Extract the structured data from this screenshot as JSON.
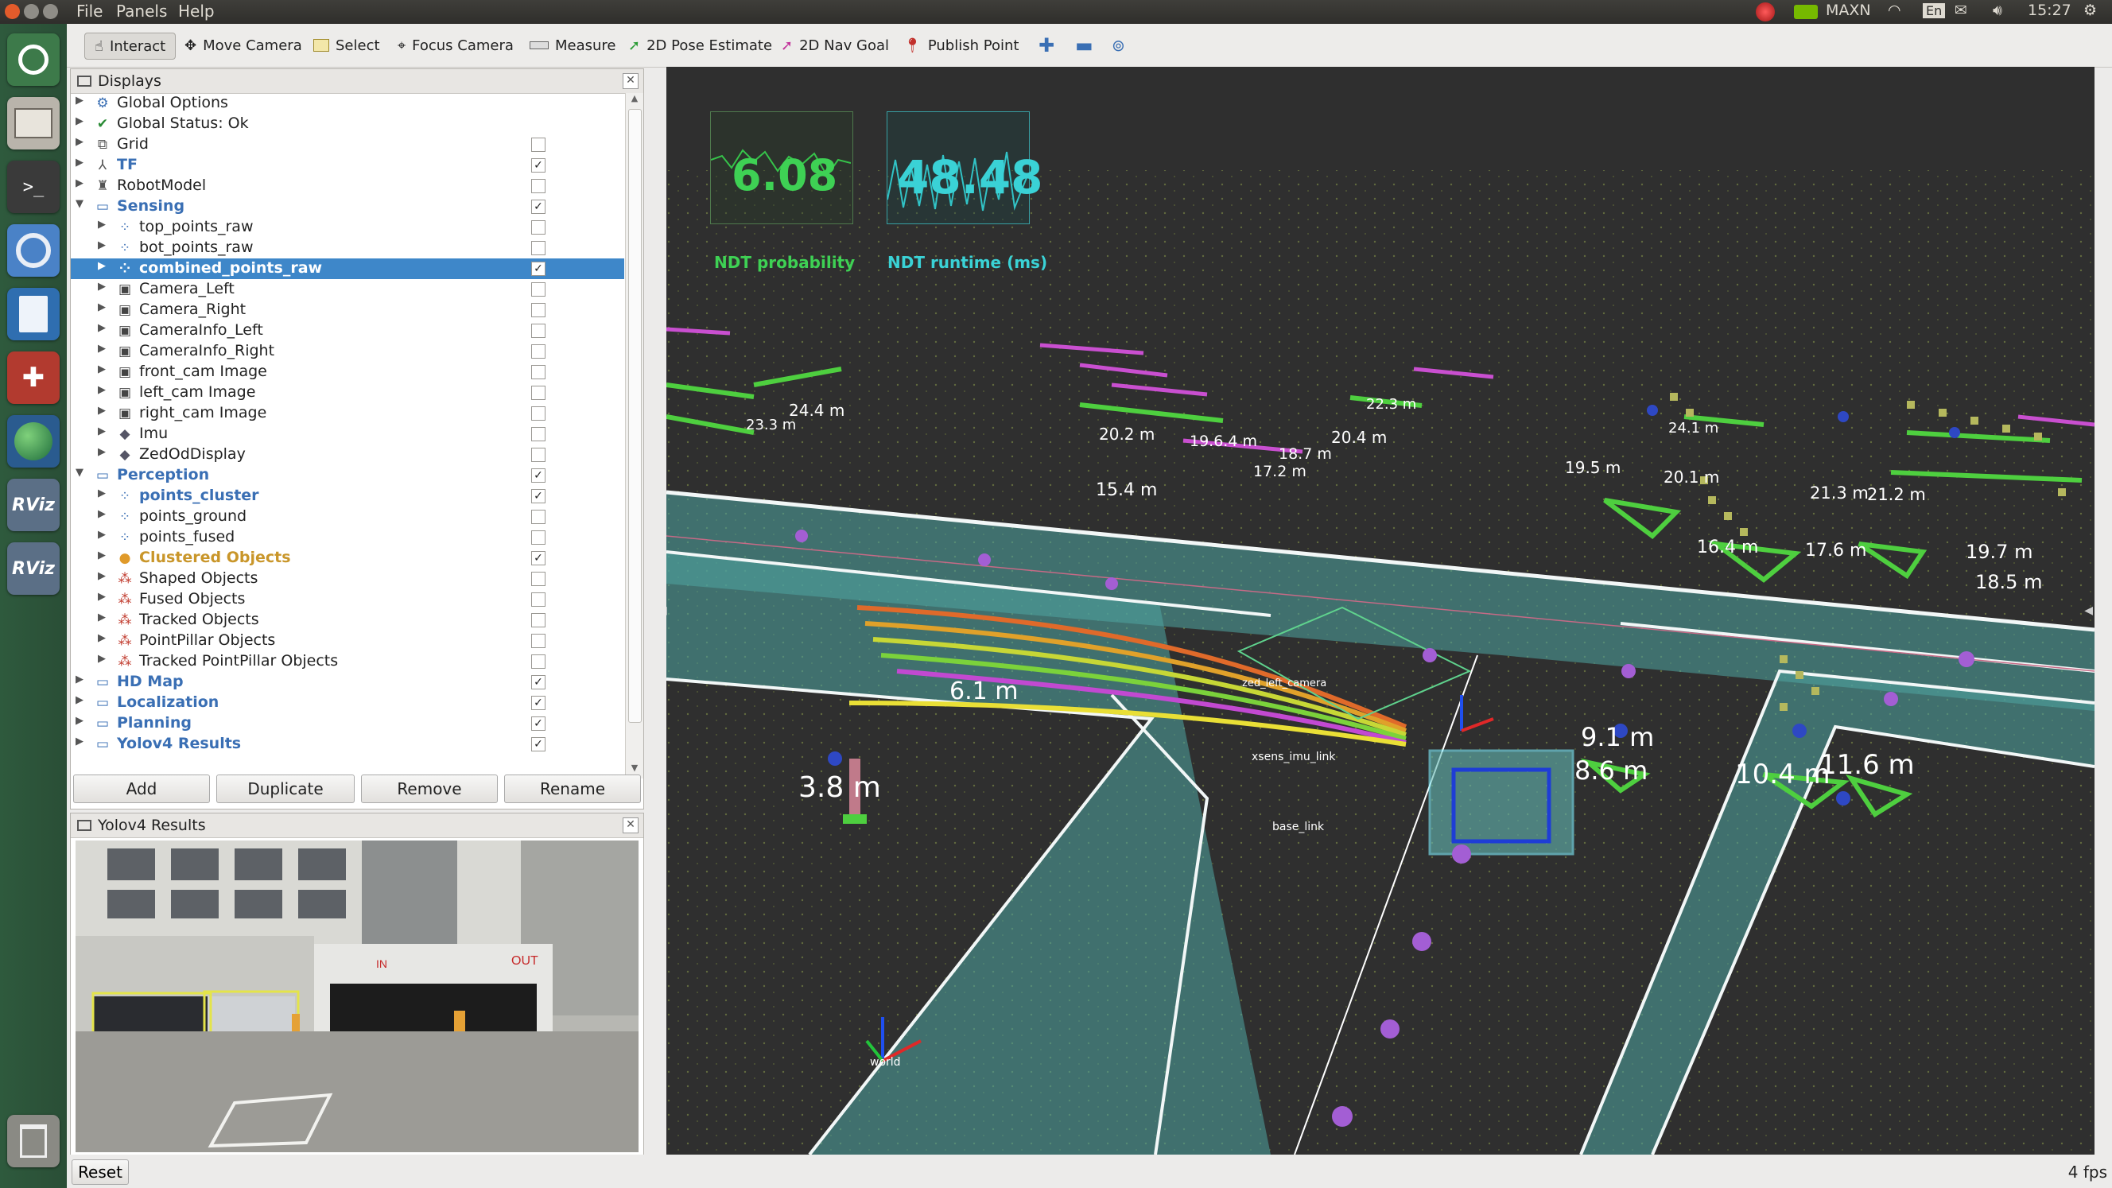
{
  "menubar": {
    "menus": [
      "File",
      "Panels",
      "Help"
    ],
    "tray": {
      "mode": "MAXN",
      "lang": "En",
      "time": "15:27"
    }
  },
  "toolbar": {
    "tools": [
      "Interact",
      "Move Camera",
      "Select",
      "Focus Camera",
      "Measure",
      "2D Pose Estimate",
      "2D Nav Goal",
      "Publish Point"
    ]
  },
  "displays": {
    "title": "Displays",
    "items": [
      {
        "label": "Global Options",
        "icon": "globe-icon",
        "indent": 0,
        "checked": null,
        "style": "normal"
      },
      {
        "label": "Global Status: Ok",
        "icon": "check-icon",
        "indent": 0,
        "checked": null,
        "style": "normal"
      },
      {
        "label": "Grid",
        "icon": "grid-icon",
        "indent": 0,
        "checked": false,
        "style": "normal"
      },
      {
        "label": "TF",
        "icon": "tf-icon",
        "indent": 0,
        "checked": true,
        "style": "group"
      },
      {
        "label": "RobotModel",
        "icon": "robot-icon",
        "indent": 0,
        "checked": false,
        "style": "normal"
      },
      {
        "label": "Sensing",
        "icon": "folder-icon",
        "indent": 0,
        "checked": true,
        "style": "group",
        "expanded": true
      },
      {
        "label": "top_points_raw",
        "icon": "pointcloud-icon",
        "indent": 1,
        "checked": false,
        "style": "normal"
      },
      {
        "label": "bot_points_raw",
        "icon": "pointcloud-icon",
        "indent": 1,
        "checked": false,
        "style": "normal"
      },
      {
        "label": "combined_points_raw",
        "icon": "pointcloud-icon",
        "indent": 1,
        "checked": true,
        "style": "selected"
      },
      {
        "label": "Camera_Left",
        "icon": "camera-icon",
        "indent": 1,
        "checked": false,
        "style": "normal"
      },
      {
        "label": "Camera_Right",
        "icon": "camera-icon",
        "indent": 1,
        "checked": false,
        "style": "normal"
      },
      {
        "label": "CameraInfo_Left",
        "icon": "camera-icon",
        "indent": 1,
        "checked": false,
        "style": "normal"
      },
      {
        "label": "CameraInfo_Right",
        "icon": "camera-icon",
        "indent": 1,
        "checked": false,
        "style": "normal"
      },
      {
        "label": "front_cam Image",
        "icon": "image-icon",
        "indent": 1,
        "checked": false,
        "style": "normal"
      },
      {
        "label": "left_cam Image",
        "icon": "image-icon",
        "indent": 1,
        "checked": false,
        "style": "normal"
      },
      {
        "label": "right_cam Image",
        "icon": "image-icon",
        "indent": 1,
        "checked": false,
        "style": "normal"
      },
      {
        "label": "Imu",
        "icon": "diamond-icon",
        "indent": 1,
        "checked": false,
        "style": "normal"
      },
      {
        "label": "ZedOdDisplay",
        "icon": "diamond-icon",
        "indent": 1,
        "checked": false,
        "style": "normal"
      },
      {
        "label": "Perception",
        "icon": "folder-icon",
        "indent": 0,
        "checked": true,
        "style": "group",
        "expanded": true
      },
      {
        "label": "points_cluster",
        "icon": "pointcloud-icon",
        "indent": 1,
        "checked": true,
        "style": "group"
      },
      {
        "label": "points_ground",
        "icon": "pointcloud-icon",
        "indent": 1,
        "checked": false,
        "style": "normal"
      },
      {
        "label": "points_fused",
        "icon": "pointcloud-icon",
        "indent": 1,
        "checked": false,
        "style": "normal"
      },
      {
        "label": "Clustered Objects",
        "icon": "warning-icon",
        "indent": 1,
        "checked": true,
        "style": "warn"
      },
      {
        "label": "Shaped Objects",
        "icon": "markers-icon",
        "indent": 1,
        "checked": false,
        "style": "normal"
      },
      {
        "label": "Fused Objects",
        "icon": "markers-icon",
        "indent": 1,
        "checked": false,
        "style": "normal"
      },
      {
        "label": "Tracked Objects",
        "icon": "markers-icon",
        "indent": 1,
        "checked": false,
        "style": "normal"
      },
      {
        "label": "PointPillar Objects",
        "icon": "markers-icon",
        "indent": 1,
        "checked": false,
        "style": "normal"
      },
      {
        "label": "Tracked PointPillar Objects",
        "icon": "markers-icon",
        "indent": 1,
        "checked": false,
        "style": "normal"
      },
      {
        "label": "HD Map",
        "icon": "folder-icon",
        "indent": 0,
        "checked": true,
        "style": "group"
      },
      {
        "label": "Localization",
        "icon": "folder-icon",
        "indent": 0,
        "checked": true,
        "style": "group"
      },
      {
        "label": "Planning",
        "icon": "folder-icon",
        "indent": 0,
        "checked": true,
        "style": "group"
      },
      {
        "label": "Yolov4 Results",
        "icon": "folder-icon",
        "indent": 0,
        "checked": true,
        "style": "group"
      }
    ],
    "buttons": {
      "add": "Add",
      "duplicate": "Duplicate",
      "remove": "Remove",
      "rename": "Rename"
    }
  },
  "yolo_panel": {
    "title": "Yolov4 Results",
    "sign_in": "IN",
    "sign_out": "OUT"
  },
  "viewport": {
    "hud": {
      "ndt_probability": "6.08",
      "ndt_probability_label": "NDT probability",
      "ndt_runtime": "48.48",
      "ndt_runtime_label": "NDT runtime (ms)"
    },
    "distance_labels": [
      "24.4 m",
      "23.3 m",
      "20.2 m",
      "19.5 m",
      "19.6.4 m",
      "18.7 m",
      "17.2 m",
      "20.4 m",
      "22.3 m",
      "19.5 m",
      "24.1 m",
      "20.1 m",
      "21.3 m",
      "21.2 m",
      "15.4 m",
      "16.4 m",
      "17.6 m",
      "19.7 m",
      "18.5 m",
      "6.1 m",
      "3.8 m",
      "9.1 m",
      "8.6 m",
      "10.4 m",
      "11.6 m"
    ],
    "frame_labels": [
      "zed_left_camera",
      "xsens_imu_link",
      "base_link",
      "world"
    ]
  },
  "statusbar": {
    "reset": "Reset",
    "fps": "4 fps"
  }
}
